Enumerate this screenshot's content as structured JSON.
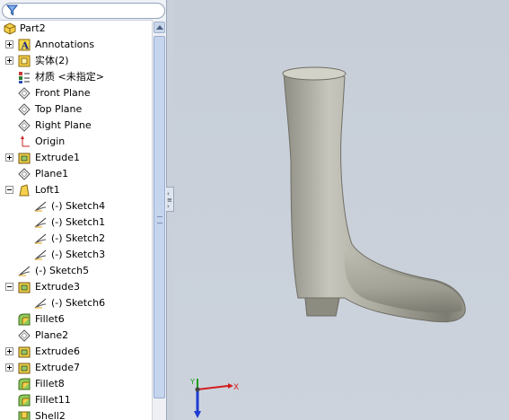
{
  "feature_tree": {
    "root": "Part2",
    "items": [
      {
        "label": "Annotations",
        "expander": "plus",
        "indent": 1,
        "icon": "annotations-icon"
      },
      {
        "label": "实体(2)",
        "expander": "plus",
        "indent": 1,
        "icon": "solid-bodies-icon"
      },
      {
        "label": "材质 <未指定>",
        "expander": "none",
        "indent": 1,
        "icon": "material-icon"
      },
      {
        "label": "Front Plane",
        "expander": "none",
        "indent": 1,
        "icon": "plane-icon"
      },
      {
        "label": "Top Plane",
        "expander": "none",
        "indent": 1,
        "icon": "plane-icon"
      },
      {
        "label": "Right Plane",
        "expander": "none",
        "indent": 1,
        "icon": "plane-icon"
      },
      {
        "label": "Origin",
        "expander": "none",
        "indent": 1,
        "icon": "origin-icon"
      },
      {
        "label": "Extrude1",
        "expander": "plus",
        "indent": 1,
        "icon": "extrude-icon"
      },
      {
        "label": "Plane1",
        "expander": "none",
        "indent": 1,
        "icon": "plane-icon"
      },
      {
        "label": "Loft1",
        "expander": "minus",
        "indent": 1,
        "icon": "loft-icon"
      },
      {
        "label": "(-) Sketch4",
        "expander": "none",
        "indent": 2,
        "icon": "sketch-icon"
      },
      {
        "label": "(-) Sketch1",
        "expander": "none",
        "indent": 2,
        "icon": "sketch-icon"
      },
      {
        "label": "(-) Sketch2",
        "expander": "none",
        "indent": 2,
        "icon": "sketch-icon"
      },
      {
        "label": "(-) Sketch3",
        "expander": "none",
        "indent": 2,
        "icon": "sketch-icon"
      },
      {
        "label": "(-) Sketch5",
        "expander": "none",
        "indent": 1,
        "icon": "sketch-icon"
      },
      {
        "label": "Extrude3",
        "expander": "minus",
        "indent": 1,
        "icon": "extrude-icon"
      },
      {
        "label": "(-) Sketch6",
        "expander": "none",
        "indent": 2,
        "icon": "sketch-icon"
      },
      {
        "label": "Fillet6",
        "expander": "none",
        "indent": 1,
        "icon": "fillet-icon"
      },
      {
        "label": "Plane2",
        "expander": "none",
        "indent": 1,
        "icon": "plane-icon"
      },
      {
        "label": "Extrude6",
        "expander": "plus",
        "indent": 1,
        "icon": "extrude-icon"
      },
      {
        "label": "Extrude7",
        "expander": "plus",
        "indent": 1,
        "icon": "extrude-icon"
      },
      {
        "label": "Fillet8",
        "expander": "none",
        "indent": 1,
        "icon": "fillet-icon"
      },
      {
        "label": "Fillet11",
        "expander": "none",
        "indent": 1,
        "icon": "fillet-icon"
      },
      {
        "label": "Shell2",
        "expander": "none",
        "indent": 1,
        "icon": "shell-icon"
      }
    ]
  },
  "filter": {
    "icon": "filter-icon"
  },
  "triad": {
    "x_label": "X",
    "y_label": "Y"
  },
  "colors": {
    "viewport_bg": "#c9d0da",
    "model": "#a9a89c",
    "triad_x": "#d21e1e",
    "triad_y": "#1e9e1e",
    "triad_z": "#1e3cd2"
  }
}
